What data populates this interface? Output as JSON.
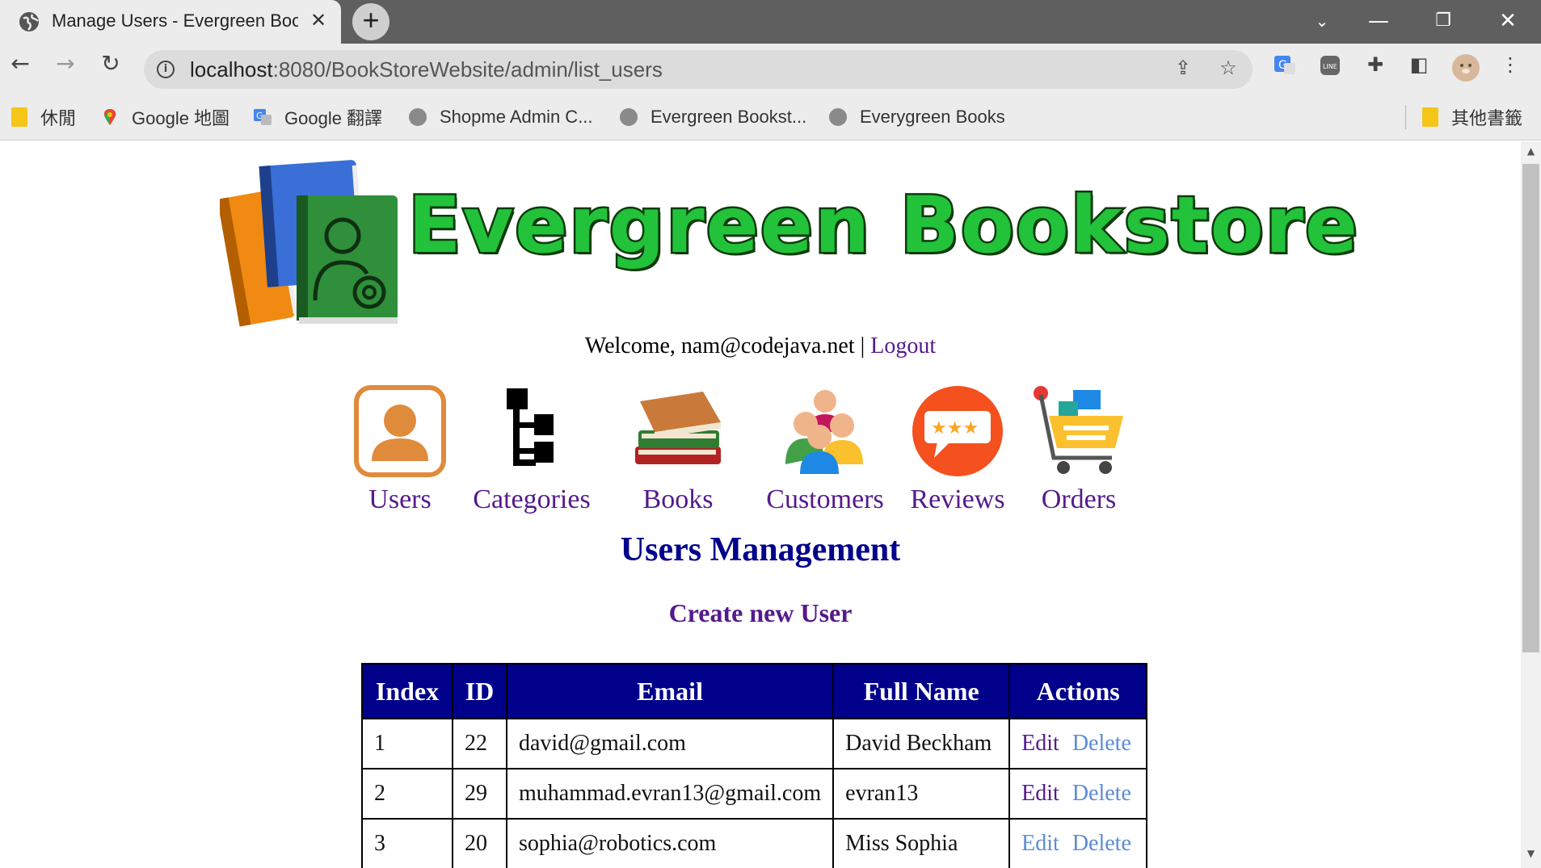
{
  "browser": {
    "tab_title": "Manage Users - Evergreen Bookstore Administration",
    "url_host": "localhost",
    "url_rest": ":8080/BookStoreWebsite/admin/list_users",
    "bookmarks": [
      {
        "label": "休閒",
        "icon": "folder-icon"
      },
      {
        "label": "Google 地圖",
        "icon": "maps-icon"
      },
      {
        "label": "Google 翻譯",
        "icon": "translate-icon"
      },
      {
        "label": "Shopme Admin C...",
        "icon": "globe-icon"
      },
      {
        "label": "Evergreen Bookst...",
        "icon": "globe-icon"
      },
      {
        "label": "Everygreen Books",
        "icon": "globe-icon"
      }
    ],
    "other_bookmarks": "其他書籤"
  },
  "header": {
    "logo_text": "Evergreen Bookstore",
    "welcome_prefix": "Welcome, nam@codejava.net | ",
    "logout_label": "Logout"
  },
  "menu": [
    {
      "label": "Users",
      "icon": "users-icon"
    },
    {
      "label": "Categories",
      "icon": "categories-icon"
    },
    {
      "label": "Books",
      "icon": "books-icon"
    },
    {
      "label": "Customers",
      "icon": "customers-icon"
    },
    {
      "label": "Reviews",
      "icon": "reviews-icon"
    },
    {
      "label": "Orders",
      "icon": "orders-icon"
    }
  ],
  "main": {
    "title": "Users Management",
    "create_label": "Create new User",
    "table": {
      "headers": [
        "Index",
        "ID",
        "Email",
        "Full Name",
        "Actions"
      ],
      "rows": [
        {
          "index": "1",
          "id": "22",
          "email": "david@gmail.com",
          "full_name": "David Beckham",
          "edit": "Edit",
          "delete": "Delete"
        },
        {
          "index": "2",
          "id": "29",
          "email": "muhammad.evran13@gmail.com",
          "full_name": "evran13",
          "edit": "Edit",
          "delete": "Delete"
        },
        {
          "index": "3",
          "id": "20",
          "email": "sophia@robotics.com",
          "full_name": "Miss Sophia",
          "edit": "Edit",
          "delete": "Delete"
        }
      ]
    }
  },
  "colors": {
    "header_bg": "#00008b",
    "link_visited": "#551a8b",
    "link": "#5b8cd6",
    "logo_green": "#22c23a"
  }
}
